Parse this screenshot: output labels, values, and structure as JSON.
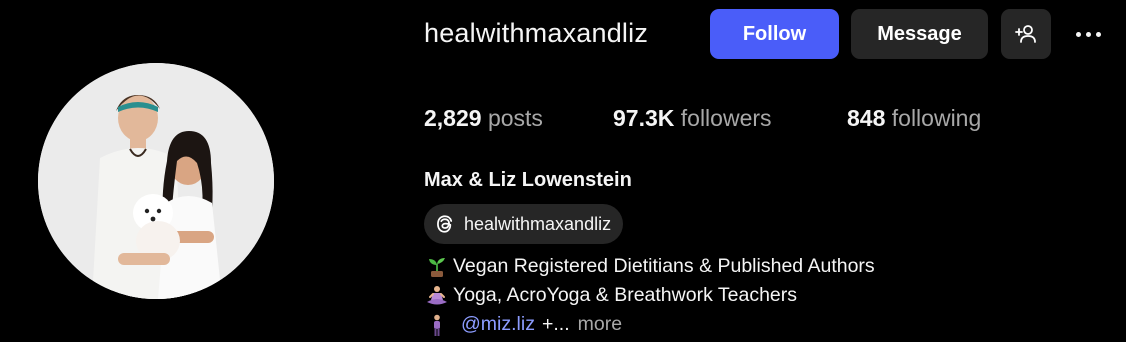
{
  "profile": {
    "username": "healwithmaxandliz",
    "full_name": "Max & Liz Lowenstein",
    "threads_handle": "healwithmaxandliz"
  },
  "actions": {
    "follow_label": "Follow",
    "message_label": "Message"
  },
  "stats": {
    "posts_count": "2,829",
    "posts_label": "posts",
    "followers_count": "97.3K",
    "followers_label": "followers",
    "following_count": "848",
    "following_label": "following"
  },
  "bio": {
    "line1": "Vegan Registered Dietitians & Published Authors",
    "line1_icon": "seedling-emoji",
    "line2": "Yoga, AcroYoga & Breathwork Teachers",
    "line2_icon": "lotus-position-emoji",
    "line3_icon": "standing-person-emoji",
    "mention": "@miz.liz",
    "mention_suffix": "+...",
    "more_label": "more"
  },
  "colors": {
    "background": "#000000",
    "follow_button": "#4a5df9",
    "secondary_button": "#262626",
    "mention_link": "#8c9cff",
    "muted_text": "#a8a8a8"
  }
}
